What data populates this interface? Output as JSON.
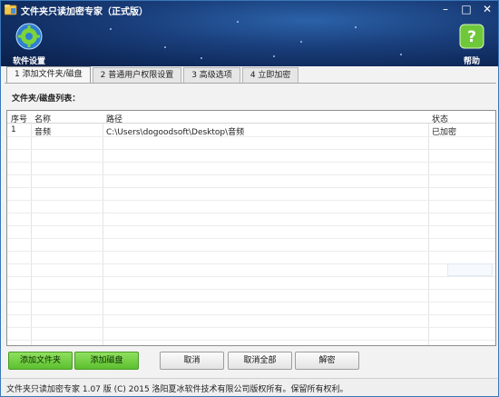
{
  "window": {
    "title": "文件夹只读加密专家（正式版）"
  },
  "toolbar": {
    "settings_label": "软件设置",
    "help_label": "帮助"
  },
  "tabs": [
    {
      "label": "1 添加文件夹/磁盘",
      "active": true
    },
    {
      "label": "2 普通用户权限设置",
      "active": false
    },
    {
      "label": "3 高级选项",
      "active": false
    },
    {
      "label": "4 立即加密",
      "active": false
    }
  ],
  "list": {
    "section_label": "文件夹/磁盘列表：",
    "columns": [
      "序号",
      "名称",
      "路径",
      "状态"
    ],
    "rows": [
      {
        "index": "1",
        "name": "音频",
        "path": "C:\\Users\\dogoodsoft\\Desktop\\音频",
        "status": "已加密"
      }
    ]
  },
  "buttons": {
    "add_folder": "添加文件夹",
    "add_disk": "添加磁盘",
    "cancel": "取消",
    "cancel_all": "取消全部",
    "decrypt": "解密"
  },
  "status_bar": {
    "text": "文件夹只读加密专家 1.07 版 (C) 2015 洛阳夏冰软件技术有限公司版权所有。保留所有权利。"
  },
  "colors": {
    "header_blue": "#1a3f7c",
    "green_button": "#6ccc3a",
    "window_border": "#3a78b8"
  }
}
